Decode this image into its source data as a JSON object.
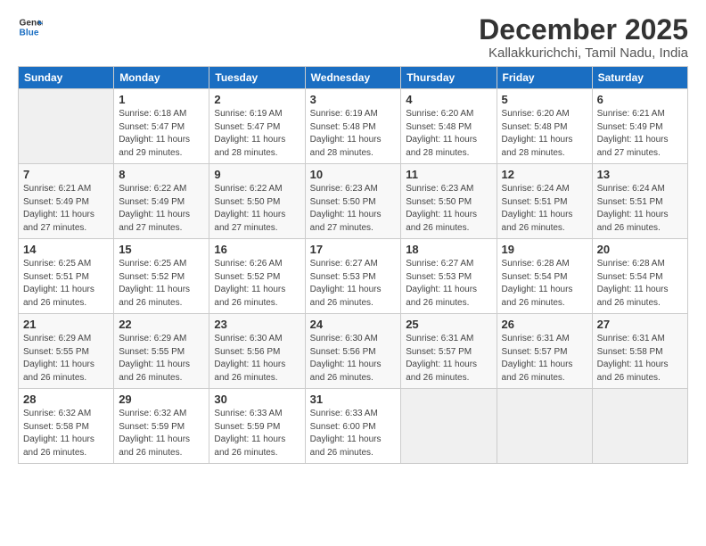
{
  "header": {
    "logo_line1": "General",
    "logo_line2": "Blue",
    "month": "December 2025",
    "location": "Kallakkurichchi, Tamil Nadu, India"
  },
  "days_of_week": [
    "Sunday",
    "Monday",
    "Tuesday",
    "Wednesday",
    "Thursday",
    "Friday",
    "Saturday"
  ],
  "weeks": [
    [
      {
        "day": "",
        "empty": true
      },
      {
        "day": "1",
        "sunrise": "Sunrise: 6:18 AM",
        "sunset": "Sunset: 5:47 PM",
        "daylight": "Daylight: 11 hours and 29 minutes."
      },
      {
        "day": "2",
        "sunrise": "Sunrise: 6:19 AM",
        "sunset": "Sunset: 5:47 PM",
        "daylight": "Daylight: 11 hours and 28 minutes."
      },
      {
        "day": "3",
        "sunrise": "Sunrise: 6:19 AM",
        "sunset": "Sunset: 5:48 PM",
        "daylight": "Daylight: 11 hours and 28 minutes."
      },
      {
        "day": "4",
        "sunrise": "Sunrise: 6:20 AM",
        "sunset": "Sunset: 5:48 PM",
        "daylight": "Daylight: 11 hours and 28 minutes."
      },
      {
        "day": "5",
        "sunrise": "Sunrise: 6:20 AM",
        "sunset": "Sunset: 5:48 PM",
        "daylight": "Daylight: 11 hours and 28 minutes."
      },
      {
        "day": "6",
        "sunrise": "Sunrise: 6:21 AM",
        "sunset": "Sunset: 5:49 PM",
        "daylight": "Daylight: 11 hours and 27 minutes."
      }
    ],
    [
      {
        "day": "7",
        "sunrise": "Sunrise: 6:21 AM",
        "sunset": "Sunset: 5:49 PM",
        "daylight": "Daylight: 11 hours and 27 minutes."
      },
      {
        "day": "8",
        "sunrise": "Sunrise: 6:22 AM",
        "sunset": "Sunset: 5:49 PM",
        "daylight": "Daylight: 11 hours and 27 minutes."
      },
      {
        "day": "9",
        "sunrise": "Sunrise: 6:22 AM",
        "sunset": "Sunset: 5:50 PM",
        "daylight": "Daylight: 11 hours and 27 minutes."
      },
      {
        "day": "10",
        "sunrise": "Sunrise: 6:23 AM",
        "sunset": "Sunset: 5:50 PM",
        "daylight": "Daylight: 11 hours and 27 minutes."
      },
      {
        "day": "11",
        "sunrise": "Sunrise: 6:23 AM",
        "sunset": "Sunset: 5:50 PM",
        "daylight": "Daylight: 11 hours and 26 minutes."
      },
      {
        "day": "12",
        "sunrise": "Sunrise: 6:24 AM",
        "sunset": "Sunset: 5:51 PM",
        "daylight": "Daylight: 11 hours and 26 minutes."
      },
      {
        "day": "13",
        "sunrise": "Sunrise: 6:24 AM",
        "sunset": "Sunset: 5:51 PM",
        "daylight": "Daylight: 11 hours and 26 minutes."
      }
    ],
    [
      {
        "day": "14",
        "sunrise": "Sunrise: 6:25 AM",
        "sunset": "Sunset: 5:51 PM",
        "daylight": "Daylight: 11 hours and 26 minutes."
      },
      {
        "day": "15",
        "sunrise": "Sunrise: 6:25 AM",
        "sunset": "Sunset: 5:52 PM",
        "daylight": "Daylight: 11 hours and 26 minutes."
      },
      {
        "day": "16",
        "sunrise": "Sunrise: 6:26 AM",
        "sunset": "Sunset: 5:52 PM",
        "daylight": "Daylight: 11 hours and 26 minutes."
      },
      {
        "day": "17",
        "sunrise": "Sunrise: 6:27 AM",
        "sunset": "Sunset: 5:53 PM",
        "daylight": "Daylight: 11 hours and 26 minutes."
      },
      {
        "day": "18",
        "sunrise": "Sunrise: 6:27 AM",
        "sunset": "Sunset: 5:53 PM",
        "daylight": "Daylight: 11 hours and 26 minutes."
      },
      {
        "day": "19",
        "sunrise": "Sunrise: 6:28 AM",
        "sunset": "Sunset: 5:54 PM",
        "daylight": "Daylight: 11 hours and 26 minutes."
      },
      {
        "day": "20",
        "sunrise": "Sunrise: 6:28 AM",
        "sunset": "Sunset: 5:54 PM",
        "daylight": "Daylight: 11 hours and 26 minutes."
      }
    ],
    [
      {
        "day": "21",
        "sunrise": "Sunrise: 6:29 AM",
        "sunset": "Sunset: 5:55 PM",
        "daylight": "Daylight: 11 hours and 26 minutes."
      },
      {
        "day": "22",
        "sunrise": "Sunrise: 6:29 AM",
        "sunset": "Sunset: 5:55 PM",
        "daylight": "Daylight: 11 hours and 26 minutes."
      },
      {
        "day": "23",
        "sunrise": "Sunrise: 6:30 AM",
        "sunset": "Sunset: 5:56 PM",
        "daylight": "Daylight: 11 hours and 26 minutes."
      },
      {
        "day": "24",
        "sunrise": "Sunrise: 6:30 AM",
        "sunset": "Sunset: 5:56 PM",
        "daylight": "Daylight: 11 hours and 26 minutes."
      },
      {
        "day": "25",
        "sunrise": "Sunrise: 6:31 AM",
        "sunset": "Sunset: 5:57 PM",
        "daylight": "Daylight: 11 hours and 26 minutes."
      },
      {
        "day": "26",
        "sunrise": "Sunrise: 6:31 AM",
        "sunset": "Sunset: 5:57 PM",
        "daylight": "Daylight: 11 hours and 26 minutes."
      },
      {
        "day": "27",
        "sunrise": "Sunrise: 6:31 AM",
        "sunset": "Sunset: 5:58 PM",
        "daylight": "Daylight: 11 hours and 26 minutes."
      }
    ],
    [
      {
        "day": "28",
        "sunrise": "Sunrise: 6:32 AM",
        "sunset": "Sunset: 5:58 PM",
        "daylight": "Daylight: 11 hours and 26 minutes."
      },
      {
        "day": "29",
        "sunrise": "Sunrise: 6:32 AM",
        "sunset": "Sunset: 5:59 PM",
        "daylight": "Daylight: 11 hours and 26 minutes."
      },
      {
        "day": "30",
        "sunrise": "Sunrise: 6:33 AM",
        "sunset": "Sunset: 5:59 PM",
        "daylight": "Daylight: 11 hours and 26 minutes."
      },
      {
        "day": "31",
        "sunrise": "Sunrise: 6:33 AM",
        "sunset": "Sunset: 6:00 PM",
        "daylight": "Daylight: 11 hours and 26 minutes."
      },
      {
        "day": "",
        "empty": true
      },
      {
        "day": "",
        "empty": true
      },
      {
        "day": "",
        "empty": true
      }
    ]
  ]
}
